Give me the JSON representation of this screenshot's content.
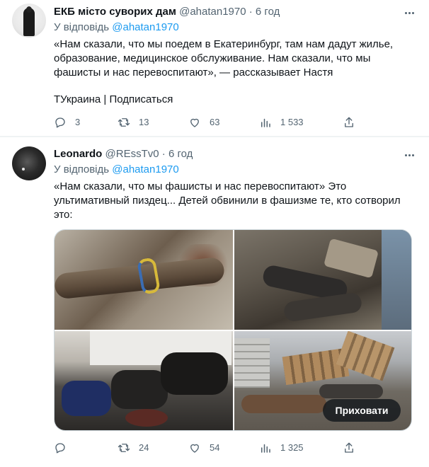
{
  "tweets": [
    {
      "display_name": "ЕКБ місто суворих дам",
      "handle": "@ahatan1970",
      "separator": "·",
      "time": "6 год",
      "reply_prefix": "У відповідь",
      "reply_mention": "@ahatan1970",
      "text": "«Нам сказали, что мы поедем в Екатеринбург, там нам дадут жилье, образование, медицинское обслуживание. Нам сказали, что мы фашисты и нас перевоспитают», — рассказывает Настя",
      "text_footer": "ТУкраина | Подписаться",
      "stats": {
        "replies": "3",
        "retweets": "13",
        "likes": "63",
        "views": "1 533"
      }
    },
    {
      "display_name": "Leonardo",
      "handle": "@REssTv0",
      "separator": "·",
      "time": "6 год",
      "reply_prefix": "У відповідь",
      "reply_mention": "@ahatan1970",
      "text": "«Нам сказали, что мы фашисты и нас перевоспитают» Это ультимативный пиздец... Детей обвинили в фашизме те, кто сотворил это:",
      "media_button": "Приховати",
      "stats": {
        "replies": "",
        "retweets": "24",
        "likes": "54",
        "views": "1 325"
      }
    }
  ],
  "colors": {
    "link": "#1d9bf0",
    "secondary": "#536471",
    "primary_text": "#0f1419"
  },
  "icons": [
    "reply-icon",
    "retweet-icon",
    "like-icon",
    "views-icon",
    "share-icon",
    "more-icon"
  ]
}
